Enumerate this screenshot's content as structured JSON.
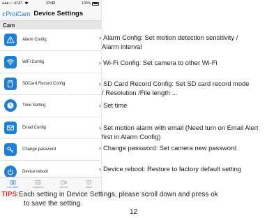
{
  "status_bar": {
    "signal": "●●●○○",
    "carrier": "AT&T",
    "time": "17:43",
    "battery": "100%"
  },
  "nav": {
    "back_label": "ProiCam",
    "title": "Device Settings"
  },
  "section": {
    "title": "Cam"
  },
  "settings": [
    {
      "label": "Alarm Config",
      "icon": "warning-icon",
      "annotation_line1": "Alarm Config: Set motion detection sensitivity /",
      "annotation_line2": "Alarm interval"
    },
    {
      "label": "WiFi Config",
      "icon": "wifi-icon",
      "annotation_line1": "Wi-Fi Config: Set camera to other Wi-Fi",
      "annotation_line2": ""
    },
    {
      "label": "SDCard Record Config",
      "icon": "sdcard-icon",
      "annotation_line1": "SD Card Record Config: Set SD card record mode",
      "annotation_line2": "/ Resolution /File length ..."
    },
    {
      "label": "Time Setting",
      "icon": "clock-icon",
      "annotation_line1": "Set time",
      "annotation_line2": ""
    },
    {
      "label": "Email Config",
      "icon": "email-icon",
      "annotation_line1": "Set motion alarm with email (Need turn on Email Alert",
      "annotation_line2": "first in Alarm Config)"
    },
    {
      "label": "Change password",
      "icon": "key-icon",
      "annotation_line1": "Change password: Set camera new password",
      "annotation_line2": ""
    },
    {
      "label": "Device reboot",
      "icon": "power-icon",
      "annotation_line1": "Device reboot: Restore to factory default setting",
      "annotation_line2": ""
    }
  ],
  "tab_bar": [
    {
      "label": "Live video",
      "icon": "camera-icon"
    },
    {
      "label": "Snapshot",
      "icon": "image-icon"
    },
    {
      "label": "Record",
      "icon": "record-icon"
    },
    {
      "label": "Alarm",
      "icon": "alert-icon"
    }
  ],
  "tips": {
    "label": "TIPS",
    "text_line1": ":Each setting in Device Settings, please scroll down and press ok",
    "text_line2": "to save the setting."
  },
  "page_number": "12",
  "colors": {
    "accent": "#1a7fe0",
    "icon_bg": "#1e7fd6",
    "tips_red": "#e23333"
  }
}
